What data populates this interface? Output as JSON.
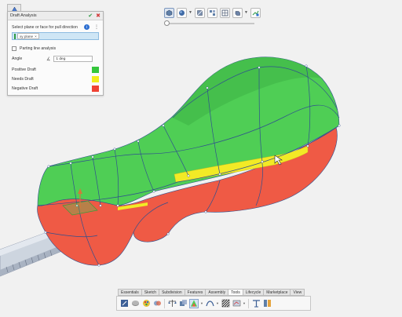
{
  "panel": {
    "title": "Draft Analysis",
    "pull_direction_label": "Select plane or face for pull direction",
    "pull_direction_value": "xy plane",
    "parting_line_label": "Parting line analysis",
    "angle_label": "Angle",
    "angle_value": "1 deg",
    "legend": [
      {
        "label": "Positive Draft",
        "color": "#35c63c"
      },
      {
        "label": "Needs Draft",
        "color": "#f2ec1c"
      },
      {
        "label": "Negative Draft",
        "color": "#ef4334"
      }
    ]
  },
  "colors": {
    "positive_draft": "#4fce55",
    "needs_draft": "#f2ea26",
    "negative_draft": "#ef5a45",
    "edge": "#2f4f8f",
    "blade": "#cdd5df"
  },
  "ribbon": {
    "tabs": [
      "Essentials",
      "Sketch",
      "Subdivision",
      "Features",
      "Assembly",
      "Tools",
      "Lifecycle",
      "Marketplace",
      "View"
    ],
    "active_tab": "Tools"
  }
}
